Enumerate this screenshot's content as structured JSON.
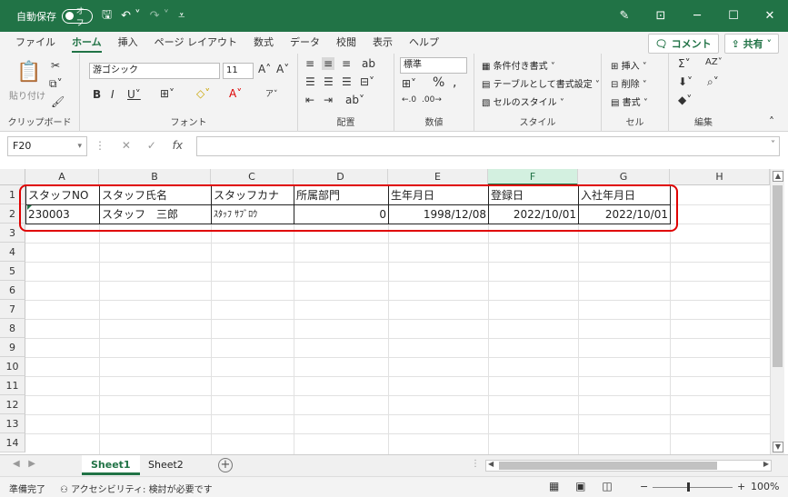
{
  "titlebar": {
    "autosave_label": "自動保存",
    "autosave_state": "オフ",
    "save_icon": "save-icon",
    "undo_icon": "undo-icon",
    "redo_icon": "redo-icon",
    "minimize": "─",
    "maximize": "☐",
    "close": "✕"
  },
  "tabs": [
    "ファイル",
    "ホーム",
    "挿入",
    "ページ レイアウト",
    "数式",
    "データ",
    "校閲",
    "表示",
    "ヘルプ"
  ],
  "active_tab": "ホーム",
  "ribbon_right": {
    "comment": "コメント",
    "share": "共有"
  },
  "ribbon": {
    "clipboard": {
      "paste": "貼り付け",
      "label": "クリップボード"
    },
    "font": {
      "name": "游ゴシック",
      "size": "11",
      "label": "フォント"
    },
    "alignment": {
      "label": "配置"
    },
    "number": {
      "format": "標準",
      "label": "数値"
    },
    "styles": {
      "conditional": "条件付き書式",
      "table": "テーブルとして書式設定",
      "cell_styles": "セルのスタイル",
      "label": "スタイル"
    },
    "cells": {
      "insert": "挿入",
      "delete": "削除",
      "format": "書式",
      "label": "セル"
    },
    "editing": {
      "label": "編集"
    }
  },
  "formula_bar": {
    "name_box": "F20",
    "formula": ""
  },
  "columns": [
    "A",
    "B",
    "C",
    "D",
    "E",
    "F",
    "G",
    "H"
  ],
  "rows": [
    "1",
    "2",
    "3",
    "4",
    "5",
    "6",
    "7",
    "8",
    "9",
    "10",
    "11",
    "12",
    "13",
    "14"
  ],
  "table": {
    "headers": [
      "スタッフNO",
      "スタッフ氏名",
      "スタッフカナ",
      "所属部門",
      "生年月日",
      "登録日",
      "入社年月日"
    ],
    "row1": [
      "230003",
      "スタッフ　三郎",
      "ｽﾀｯﾌ ｻﾌﾞﾛｳ",
      "0",
      "1998/12/08",
      "2022/10/01",
      "2022/10/01"
    ]
  },
  "sheets": [
    "Sheet1",
    "Sheet2"
  ],
  "status": {
    "ready": "準備完了",
    "accessibility": "アクセシビリティ: 検討が必要です",
    "zoom": "100%"
  }
}
